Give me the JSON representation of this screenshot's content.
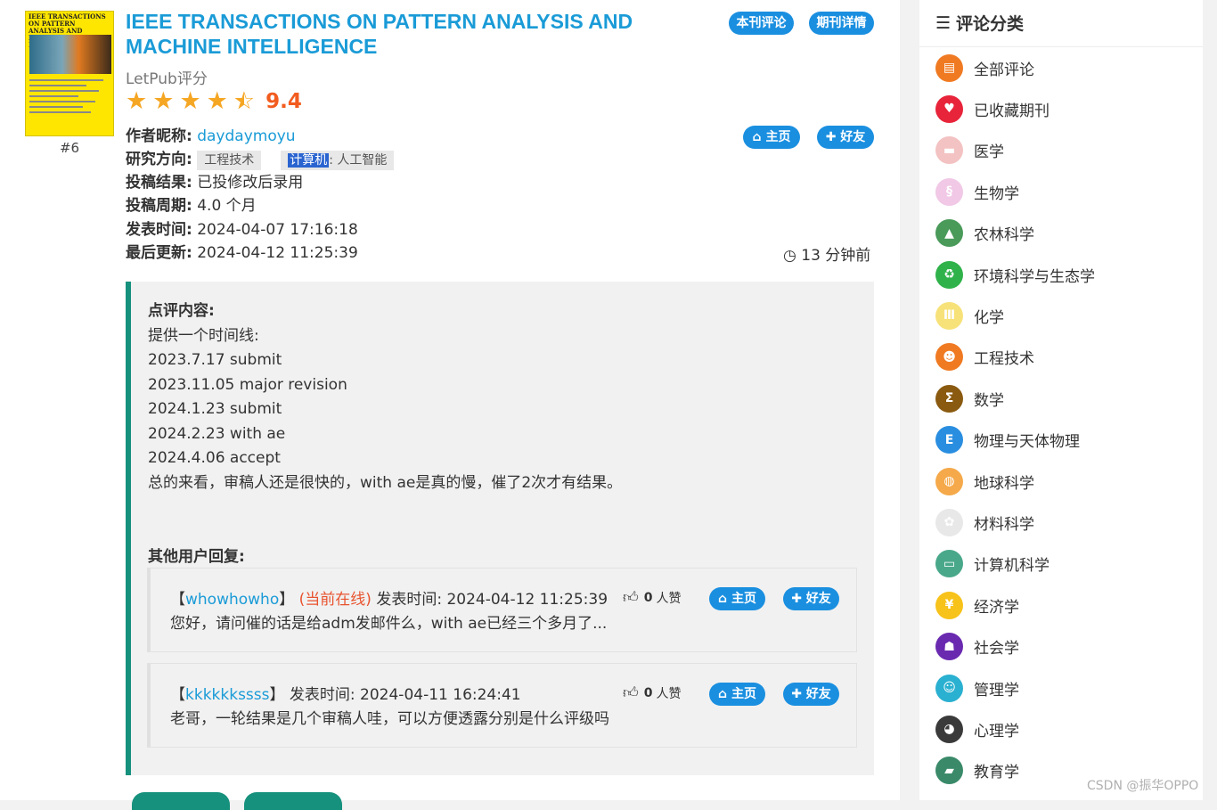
{
  "journal": {
    "cover_header": "IEEE TRANSACTIONS ON PATTERN ANALYSIS AND MACHINE INTELLIGENCE",
    "rank": "#6",
    "title_line1": "IEEE TRANSACTIONS ON PATTERN ANALYSIS AND",
    "title_line2": "MACHINE INTELLIGENCE",
    "btn_reviews": "本刊评论",
    "btn_details": "期刊详情",
    "rating_label": "LetPub评分",
    "rating_value": "9.4",
    "rating_stars": 4.5
  },
  "author": {
    "label_name": "作者昵称:",
    "name": "daydaymoyu",
    "label_field": "研究方向:",
    "field1": "工程技术",
    "field2_highlight": "计算机",
    "field2_rest": ": 人工智能",
    "label_result": "投稿结果:",
    "result": "已投修改后录用",
    "label_period": "投稿周期:",
    "period": "4.0 个月",
    "label_published": "发表时间:",
    "published": "2024-04-07 17:16:18",
    "label_updated": "最后更新:",
    "updated": "2024-04-12 11:25:39",
    "time_ago": "13 分钟前",
    "btn_home": "主页",
    "btn_friend": "好友"
  },
  "review": {
    "label": "点评内容:",
    "lines": [
      "提供一个时间线:",
      "2023.7.17 submit",
      "2023.11.05 major revision",
      "2024.1.23 submit",
      "2024.2.23 with ae",
      "2024.4.06 accept",
      "总的来看，审稿人还是很快的，with ae是真的慢，催了2次才有结果。"
    ],
    "replies_label": "其他用户回复:"
  },
  "replies": [
    {
      "bracket_open": "【",
      "user": "whowhowho",
      "bracket_close": "】",
      "online": "(当前在线)",
      "time_label": "发表时间:",
      "time": "2024-04-12 11:25:39",
      "likes": "0",
      "likes_unit": "人赞",
      "text": "您好，请问催的话是给adm发邮件么，with ae已经三个多月了...",
      "btn_home": "主页",
      "btn_friend": "好友"
    },
    {
      "bracket_open": "【",
      "user": "kkkkkkssss",
      "bracket_close": "】",
      "online": "",
      "time_label": "发表时间:",
      "time": "2024-04-11 16:24:41",
      "likes": "0",
      "likes_unit": "人赞",
      "text": "老哥，一轮结果是几个审稿人哇，可以方便透露分别是什么评级吗",
      "btn_home": "主页",
      "btn_friend": "好友"
    }
  ],
  "sidebar": {
    "title": "评论分类",
    "items": [
      {
        "label": "全部评论",
        "icon": "clipboard-icon",
        "color": "#f07a22"
      },
      {
        "label": "已收藏期刊",
        "icon": "heart-icon",
        "color": "#e8243a"
      },
      {
        "label": "医学",
        "icon": "pill-icon",
        "color": "#f3c2c2"
      },
      {
        "label": "生物学",
        "icon": "dna-icon",
        "color": "#f1c8e6"
      },
      {
        "label": "农林科学",
        "icon": "tree-icon",
        "color": "#4a9a5a"
      },
      {
        "label": "环境科学与生态学",
        "icon": "recycle-icon",
        "color": "#2fb24a"
      },
      {
        "label": "化学",
        "icon": "test-tubes-icon",
        "color": "#f7e27a"
      },
      {
        "label": "工程技术",
        "icon": "engineer-icon",
        "color": "#f07a22"
      },
      {
        "label": "数学",
        "icon": "sigma-icon",
        "color": "#8a5a10"
      },
      {
        "label": "物理与天体物理",
        "icon": "emc2-icon",
        "color": "#2a8ee0"
      },
      {
        "label": "地球科学",
        "icon": "globe-icon",
        "color": "#f5a94a"
      },
      {
        "label": "材料科学",
        "icon": "molecule-icon",
        "color": "#e8e8e8"
      },
      {
        "label": "计算机科学",
        "icon": "monitor-icon",
        "color": "#4aa88a"
      },
      {
        "label": "经济学",
        "icon": "yen-icon",
        "color": "#f7c21a"
      },
      {
        "label": "社会学",
        "icon": "people-icon",
        "color": "#6a2ab0"
      },
      {
        "label": "管理学",
        "icon": "manager-icon",
        "color": "#2ab0d0"
      },
      {
        "label": "心理学",
        "icon": "head-icon",
        "color": "#3a3a3a"
      },
      {
        "label": "教育学",
        "icon": "graduation-cap-icon",
        "color": "#3a8a6a"
      }
    ]
  },
  "watermark": "CSDN @振华OPPO"
}
